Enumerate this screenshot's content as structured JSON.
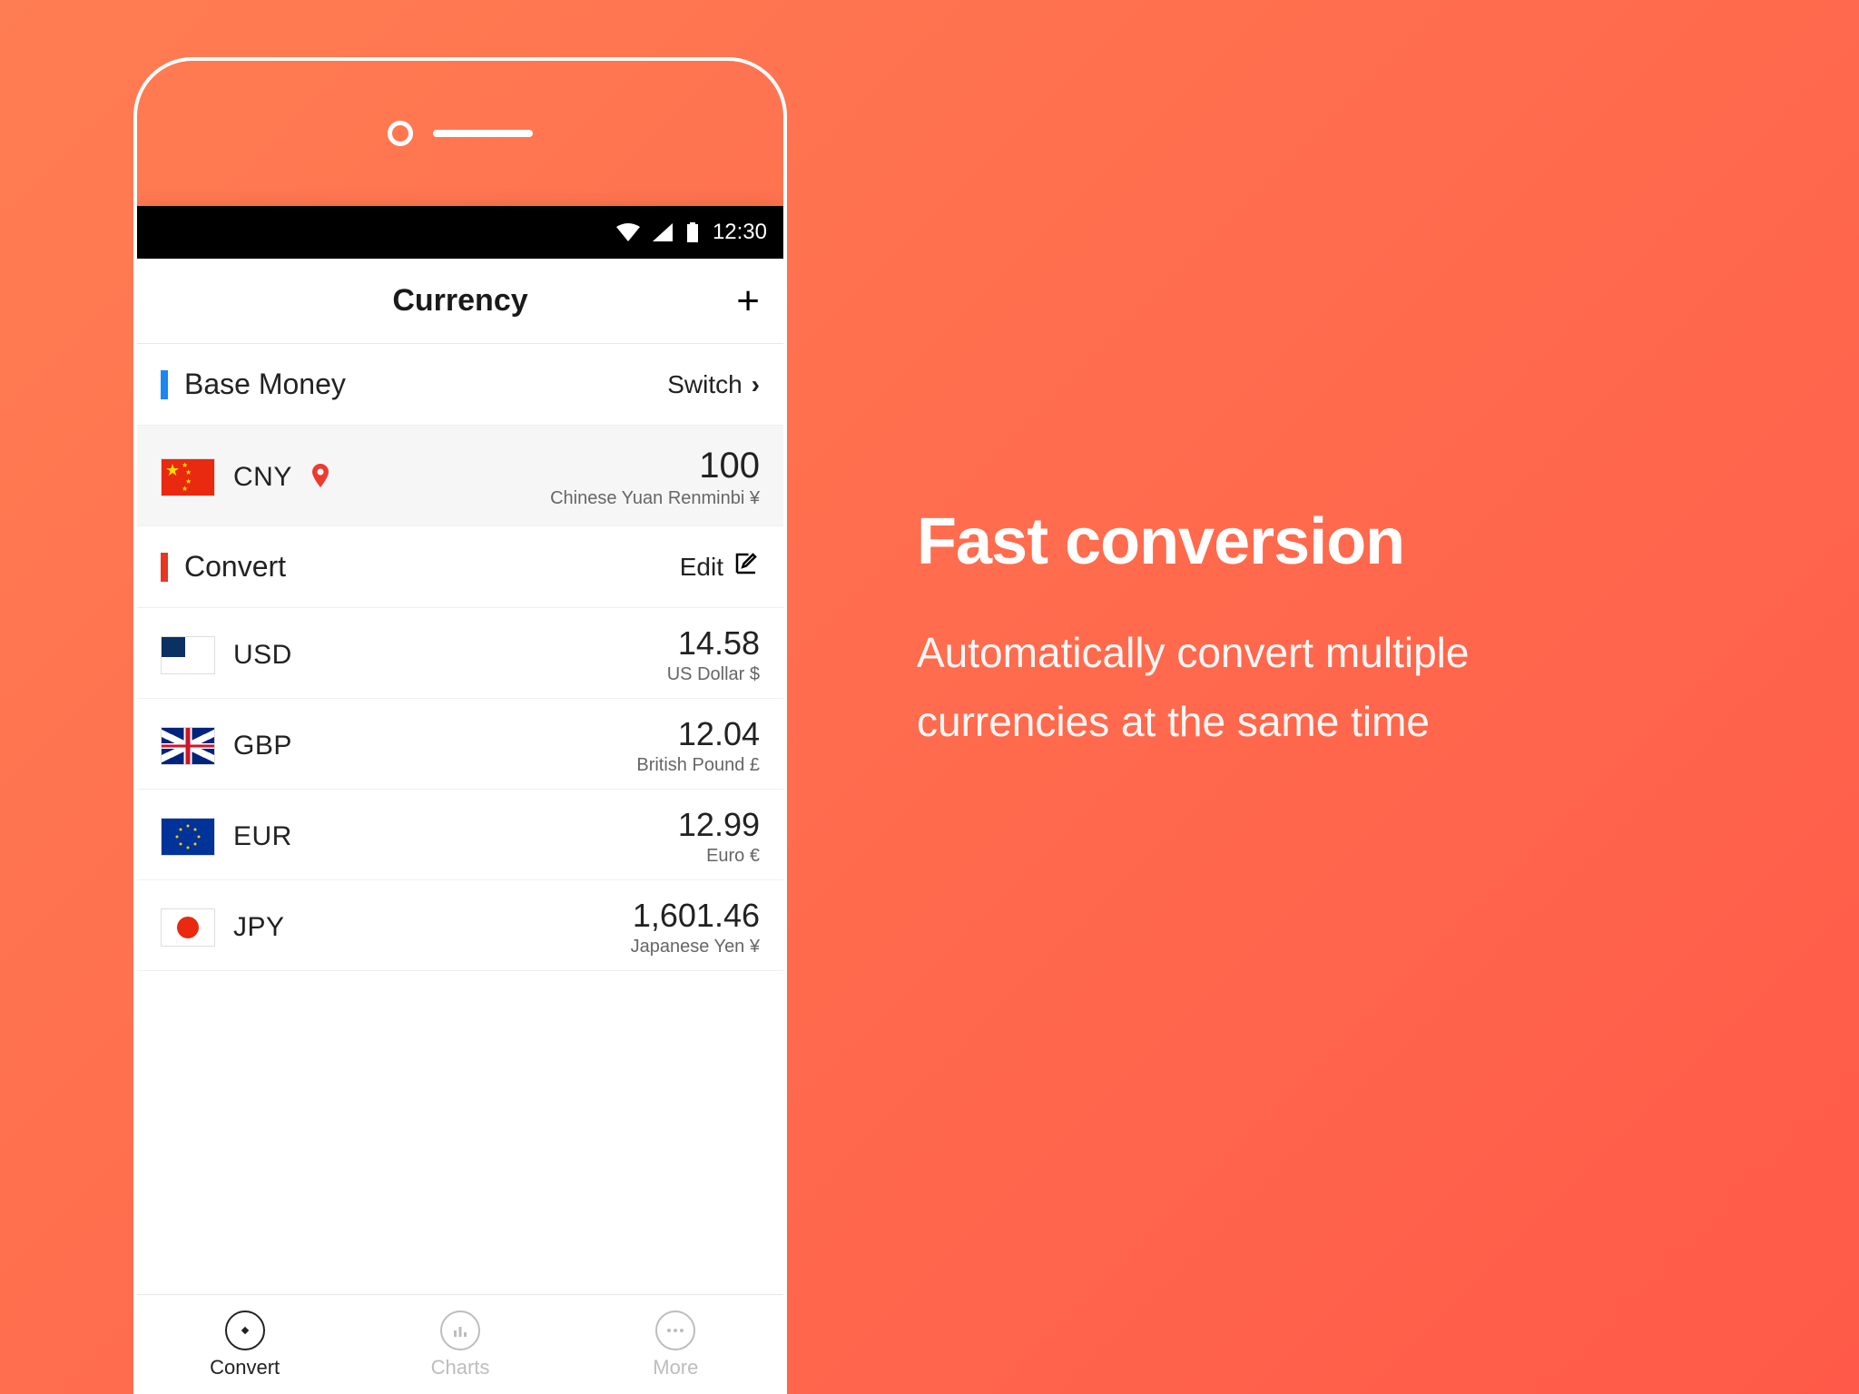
{
  "status": {
    "time": "12:30"
  },
  "header": {
    "title": "Currency"
  },
  "baseSection": {
    "label": "Base Money",
    "action": "Switch"
  },
  "base": {
    "code": "CNY",
    "amount": "100",
    "desc": "Chinese Yuan Renminbi ¥"
  },
  "convertSection": {
    "label": "Convert",
    "action": "Edit"
  },
  "rows": [
    {
      "code": "USD",
      "amount": "14.58",
      "desc": "US Dollar $"
    },
    {
      "code": "GBP",
      "amount": "12.04",
      "desc": "British Pound £"
    },
    {
      "code": "EUR",
      "amount": "12.99",
      "desc": "Euro €"
    },
    {
      "code": "JPY",
      "amount": "1,601.46",
      "desc": "Japanese Yen ¥"
    }
  ],
  "tabs": {
    "convert": "Convert",
    "charts": "Charts",
    "more": "More"
  },
  "promo": {
    "title": "Fast conversion",
    "line1": "Automatically convert multiple",
    "line2": "currencies at the same time"
  }
}
